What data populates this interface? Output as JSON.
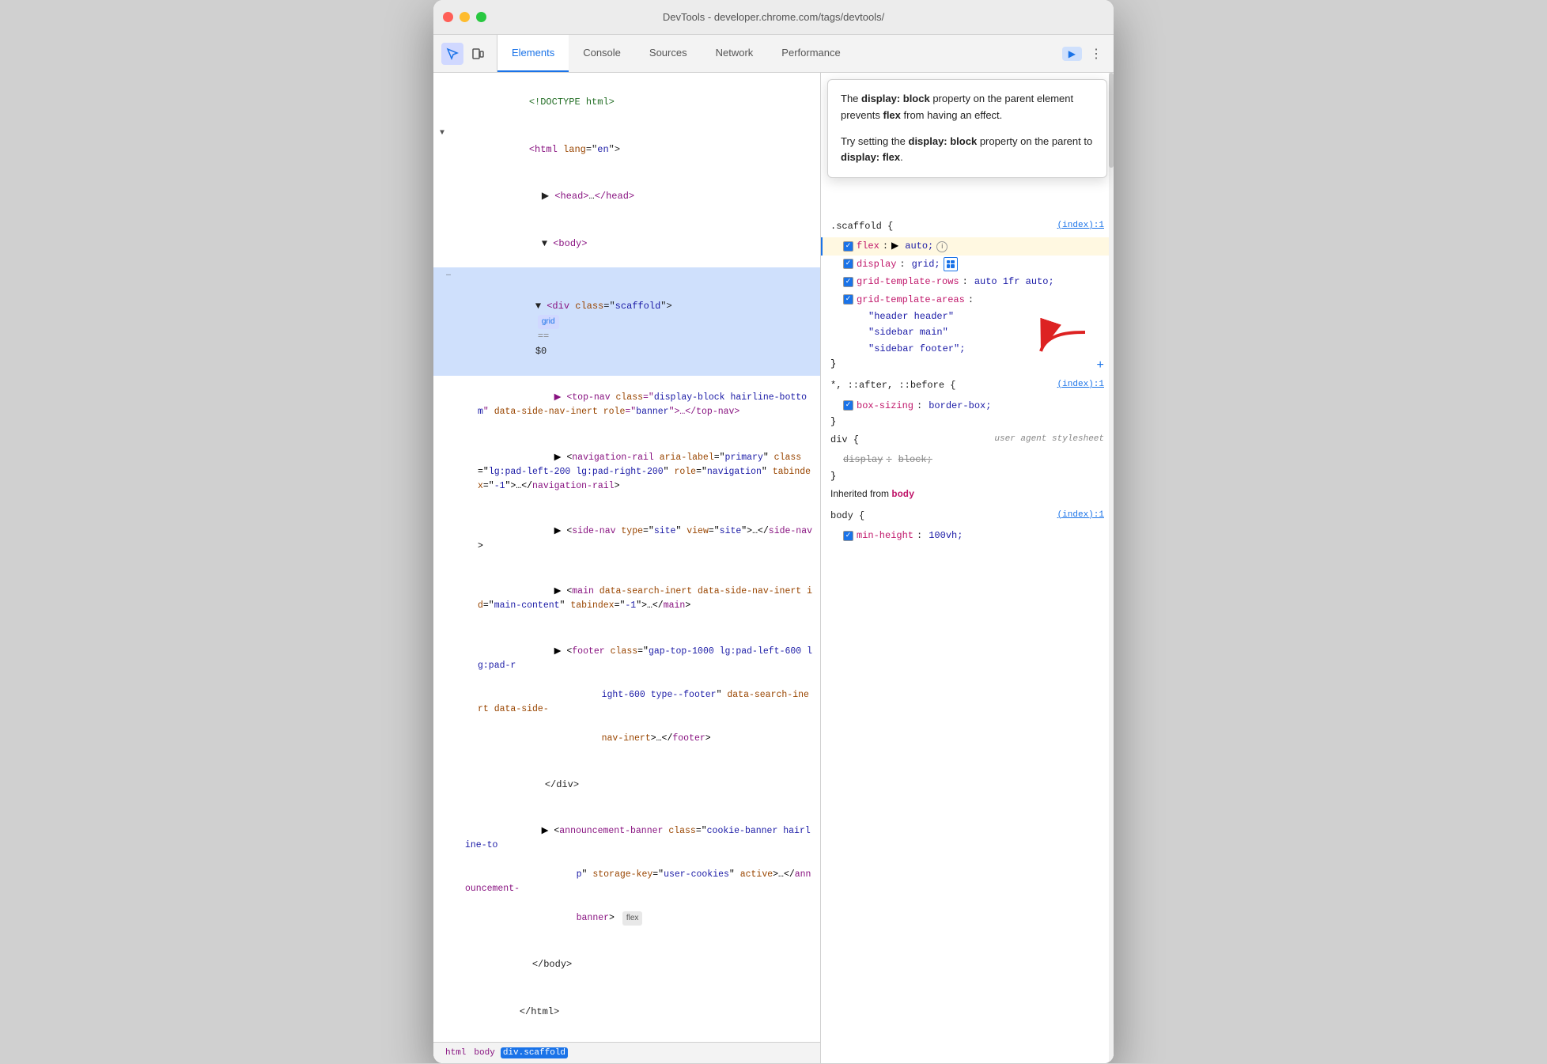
{
  "window": {
    "title": "DevTools - developer.chrome.com/tags/devtools/"
  },
  "toolbar": {
    "tabs": [
      "Elements",
      "Console",
      "Sources",
      "Network",
      "Performance"
    ],
    "active_tab": "Elements",
    "icons": [
      "cursor",
      "mobile"
    ],
    "more_label": "⋮"
  },
  "dom_panel": {
    "lines": [
      {
        "indent": 0,
        "text": "<!DOCTYPE html>",
        "type": "doctype"
      },
      {
        "indent": 0,
        "text": "<html lang=\"en\">",
        "type": "tag"
      },
      {
        "indent": 1,
        "text": "<head>…</head>",
        "type": "collapsed"
      },
      {
        "indent": 1,
        "text": "<body>",
        "type": "tag"
      },
      {
        "indent": 2,
        "text": "<div class=\"scaffold\">",
        "type": "selected",
        "badge": "grid",
        "dollar": "== $0"
      },
      {
        "indent": 3,
        "text": "<top-nav class=\"display-block hairline-bottom\" data-side-nav-inert role=\"banner\">…</top-nav>",
        "type": "tag"
      },
      {
        "indent": 3,
        "text": "<navigation-rail aria-label=\"primary\" class=\"lg:pad-left-200 lg:pad-right-200\" role=\"navigation\" tabindex=\"-1\">…</navigation-rail>",
        "type": "tag"
      },
      {
        "indent": 3,
        "text": "<side-nav type=\"site\" view=\"site\">…</side-nav>",
        "type": "tag"
      },
      {
        "indent": 3,
        "text": "<main data-search-inert data-side-nav-inert id=\"main-content\" tabindex=\"-1\">…</main>",
        "type": "tag"
      },
      {
        "indent": 3,
        "text": "<footer class=\"gap-top-1000 lg:pad-left-600 lg:pad-right-600 type--footer\" data-search-inert data-side-nav-inert>…</footer>",
        "type": "tag"
      },
      {
        "indent": 2,
        "text": "</div>",
        "type": "plain"
      },
      {
        "indent": 1,
        "text": "<announcement-banner class=\"cookie-banner hairline-top\" storage-key=\"user-cookies\" active>…</announcement-banner>",
        "type": "tag",
        "badge": "flex"
      },
      {
        "indent": 1,
        "text": "</body>",
        "type": "plain"
      },
      {
        "indent": 0,
        "text": "</html>",
        "type": "plain"
      }
    ]
  },
  "breadcrumb": {
    "items": [
      "html",
      "body",
      "div.scaffold"
    ]
  },
  "tooltip": {
    "text1_prefix": "The ",
    "text1_strong1": "display: block",
    "text1_mid": " property on the parent element prevents ",
    "text1_strong2": "flex",
    "text1_suffix": " from having an effect.",
    "text2_prefix": "Try setting the ",
    "text2_strong1": "display: block",
    "text2_mid": " property on the parent to ",
    "text2_strong2": "display: flex",
    "text2_suffix": "."
  },
  "styles": {
    "rule1": {
      "selector": ".scaffold {",
      "source": "(index):1",
      "properties": [
        {
          "name": "flex",
          "colon": ":",
          "value": "▶ auto;",
          "checked": true,
          "info": true,
          "highlighted": true
        },
        {
          "name": "display",
          "colon": ":",
          "value": "grid;",
          "checked": true,
          "grid_icon": true
        },
        {
          "name": "grid-template-rows",
          "colon": ":",
          "value": "auto 1fr auto;",
          "checked": true
        },
        {
          "name": "grid-template-areas",
          "colon": ":",
          "value": "",
          "checked": true
        },
        {
          "name": "",
          "colon": "",
          "value": "\"header header\"",
          "checked": false,
          "indent": true
        },
        {
          "name": "",
          "colon": "",
          "value": "\"sidebar main\"",
          "checked": false,
          "indent": true
        },
        {
          "name": "",
          "colon": "",
          "value": "\"sidebar footer\";",
          "checked": false,
          "indent": true
        }
      ]
    },
    "rule2": {
      "selector": "*, ::after, ::before {",
      "source": "(index):1",
      "properties": [
        {
          "name": "box-sizing",
          "colon": ":",
          "value": "border-box;"
        }
      ]
    },
    "rule3": {
      "selector": "div {",
      "source_label": "user agent stylesheet",
      "properties": [
        {
          "name": "display",
          "colon": ":",
          "value": "block;",
          "strikethrough": true
        }
      ]
    },
    "inherited_label": "Inherited from",
    "inherited_from": "body",
    "rule4": {
      "selector": "body {",
      "source": "(index):1",
      "properties": [
        {
          "name": "min-height",
          "colon": ":",
          "value": "100vh;"
        }
      ]
    }
  },
  "colors": {
    "accent": "#1a73e8",
    "tag_color": "#881280",
    "attr_name_color": "#994500",
    "attr_value_color": "#1a1aa6",
    "selected_bg": "#cfe0fc",
    "prop_name_color": "#c0166a"
  }
}
